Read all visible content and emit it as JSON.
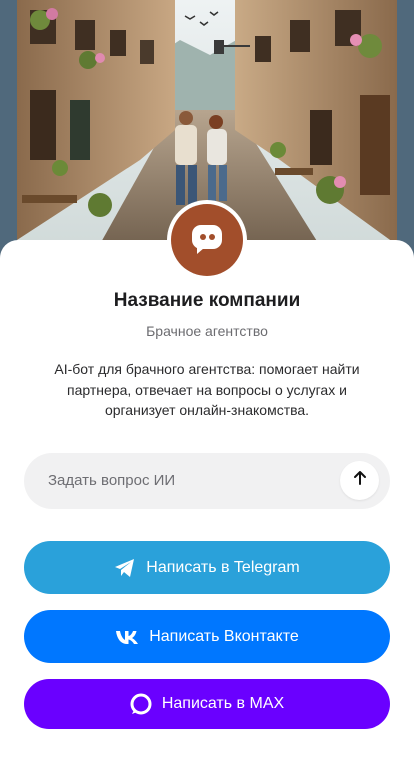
{
  "header": {
    "image_alt": "couple walking on a cobblestone street"
  },
  "company": {
    "name": "Название компании",
    "category": "Брачное агентство",
    "description": "AI-бот для брачного агентства: помогает найти партнера, отвечает на вопросы о услугах и организует онлайн-знакомства.",
    "avatar_icon": "chat-bubble-icon",
    "avatar_color": "#a24e2b"
  },
  "ask": {
    "placeholder": "Задать вопрос ИИ",
    "send_icon": "arrow-up-icon"
  },
  "actions": [
    {
      "label": "Написать в Telegram",
      "icon": "telegram-icon",
      "color": "#2aa1da"
    },
    {
      "label": "Написать Вконтакте",
      "icon": "vk-icon",
      "color": "#0077ff"
    },
    {
      "label": "Написать в MAX",
      "icon": "max-icon",
      "color": "#6a00ff"
    }
  ]
}
